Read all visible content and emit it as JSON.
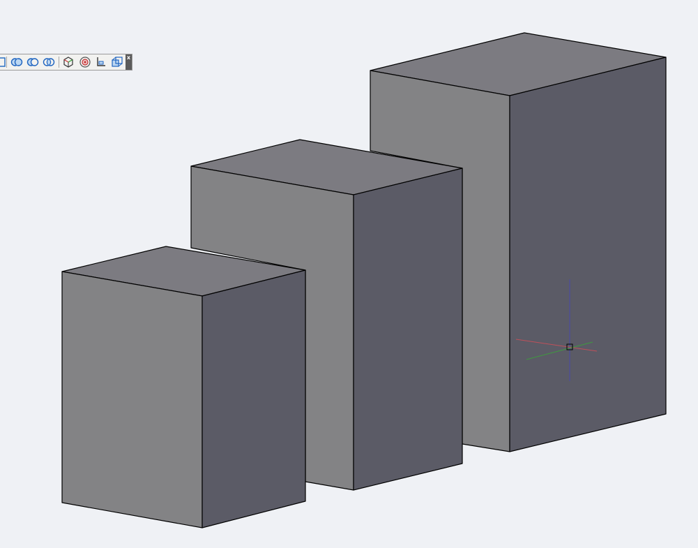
{
  "viewport": {
    "background": "#eff1f5"
  },
  "colors": {
    "top_face": "#7c7b81",
    "front_face": "#838385",
    "side_face": "#5b5b66",
    "edge": "#000000",
    "ucs_x": "#c0505a",
    "ucs_y": "#3f9a3f",
    "ucs_z": "#4a4aa8"
  },
  "toolbar": {
    "close_label": "x",
    "buttons": [
      "partial-icon",
      "union-icon",
      "subtract-icon",
      "intersect-icon",
      "view-cube-icon",
      "orbit-icon",
      "ucs-icon",
      "3d-views-icon"
    ]
  },
  "objects": [
    "box-small",
    "box-medium",
    "box-large"
  ],
  "cursor": "crosshair-cursor"
}
